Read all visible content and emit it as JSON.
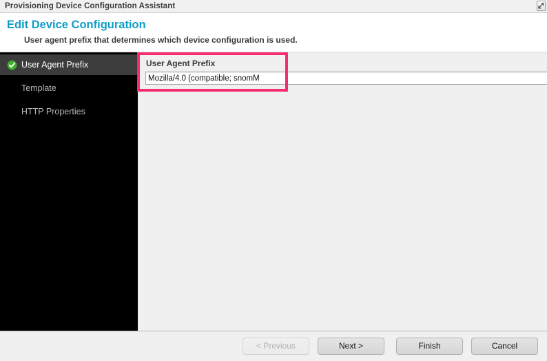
{
  "titlebar": {
    "title": "Provisioning Device Configuration Assistant",
    "restore_icon": "restore-window-icon"
  },
  "header": {
    "title": "Edit Device Configuration",
    "subtitle": "User agent prefix that determines which device configuration is used.",
    "title_color": "#0e9dc8"
  },
  "sidebar": {
    "items": [
      {
        "label": "User Agent Prefix",
        "selected": true,
        "completed": true,
        "icon": "green-check-icon"
      },
      {
        "label": "Template",
        "selected": false,
        "completed": false,
        "icon": ""
      },
      {
        "label": "HTTP Properties",
        "selected": false,
        "completed": false,
        "icon": ""
      }
    ]
  },
  "content": {
    "field_label": "User Agent Prefix",
    "field_value": "Mozilla/4.0 (compatible; snomM",
    "field_placeholder": ""
  },
  "highlight": {
    "color": "#f72c6e"
  },
  "footer": {
    "buttons": [
      {
        "label": "< Previous",
        "disabled": true
      },
      {
        "label": "Next >",
        "disabled": false
      },
      {
        "label": "Finish",
        "disabled": false
      },
      {
        "label": "Cancel",
        "disabled": false
      }
    ]
  }
}
